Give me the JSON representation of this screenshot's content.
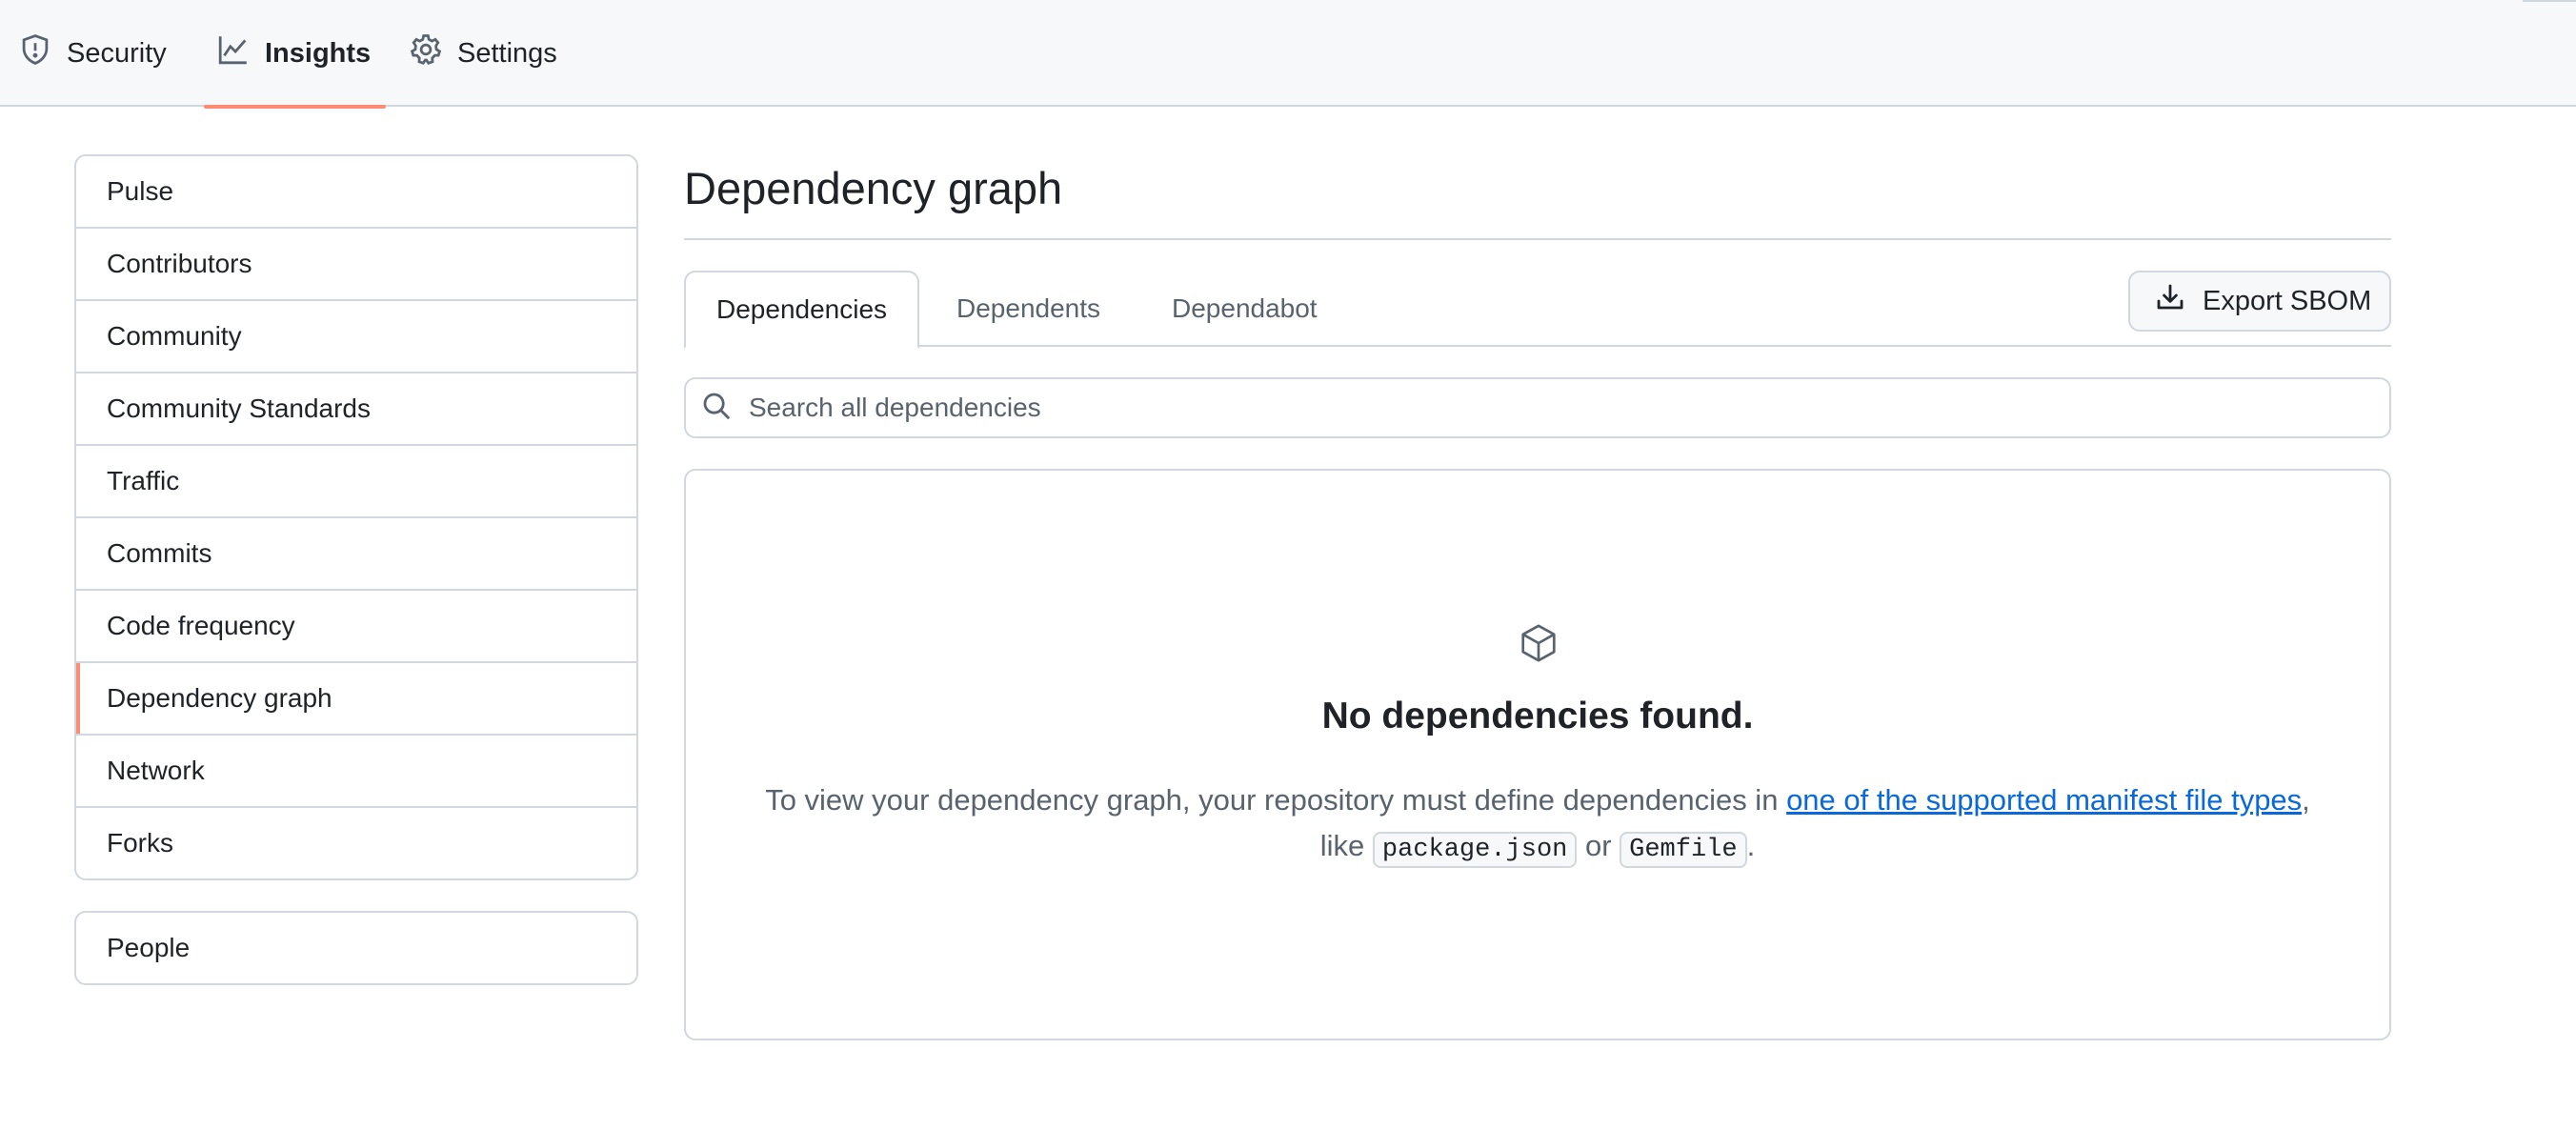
{
  "topnav": {
    "tabs": [
      {
        "label": "Security",
        "icon": "shield-icon"
      },
      {
        "label": "Insights",
        "icon": "graph-icon",
        "active": true
      },
      {
        "label": "Settings",
        "icon": "gear-icon"
      }
    ]
  },
  "sidebar": {
    "items": [
      {
        "label": "Pulse"
      },
      {
        "label": "Contributors"
      },
      {
        "label": "Community"
      },
      {
        "label": "Community Standards"
      },
      {
        "label": "Traffic"
      },
      {
        "label": "Commits"
      },
      {
        "label": "Code frequency"
      },
      {
        "label": "Dependency graph",
        "selected": true
      },
      {
        "label": "Network"
      },
      {
        "label": "Forks"
      }
    ],
    "people": {
      "label": "People"
    }
  },
  "main": {
    "title": "Dependency graph",
    "tabs": [
      {
        "label": "Dependencies",
        "active": true
      },
      {
        "label": "Dependents"
      },
      {
        "label": "Dependabot"
      }
    ],
    "export_label": "Export SBOM",
    "search": {
      "placeholder": "Search all dependencies",
      "value": ""
    },
    "blankslate": {
      "icon": "package-icon",
      "heading": "No dependencies found.",
      "text_before": "To view your dependency graph, your repository must define dependencies in ",
      "link_text": "one of the supported manifest file types",
      "text_like": ", like ",
      "code1": "package.json",
      "text_or": " or ",
      "code2": "Gemfile",
      "text_end": "."
    }
  },
  "colors": {
    "accent": "#fd8c73",
    "link": "#0969da",
    "border": "#d0d7de",
    "muted": "#59636e"
  }
}
